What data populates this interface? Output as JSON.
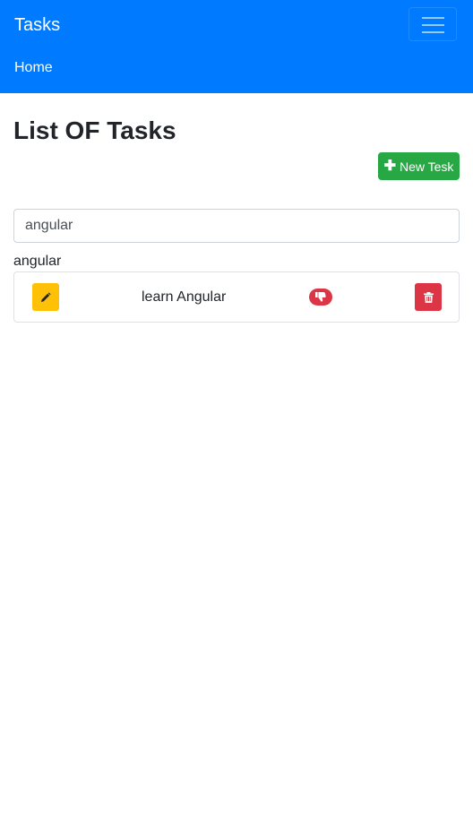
{
  "navbar": {
    "brand": "Tasks",
    "home_link": "Home",
    "bg_color": "#007bff",
    "toggler_icon": "hamburger-icon"
  },
  "page": {
    "title": "List OF Tasks",
    "new_task_button": "New Tesk",
    "new_task_icon": "plus-icon"
  },
  "search": {
    "value": "angular",
    "echo": "angular"
  },
  "tasks": [
    {
      "name": "learn Angular",
      "edit_icon": "pencil-icon",
      "status_icon": "thumbs-down-icon",
      "delete_icon": "trash-icon"
    }
  ],
  "colors": {
    "success": "#28a745",
    "warning": "#ffc107",
    "danger": "#dc3545"
  }
}
